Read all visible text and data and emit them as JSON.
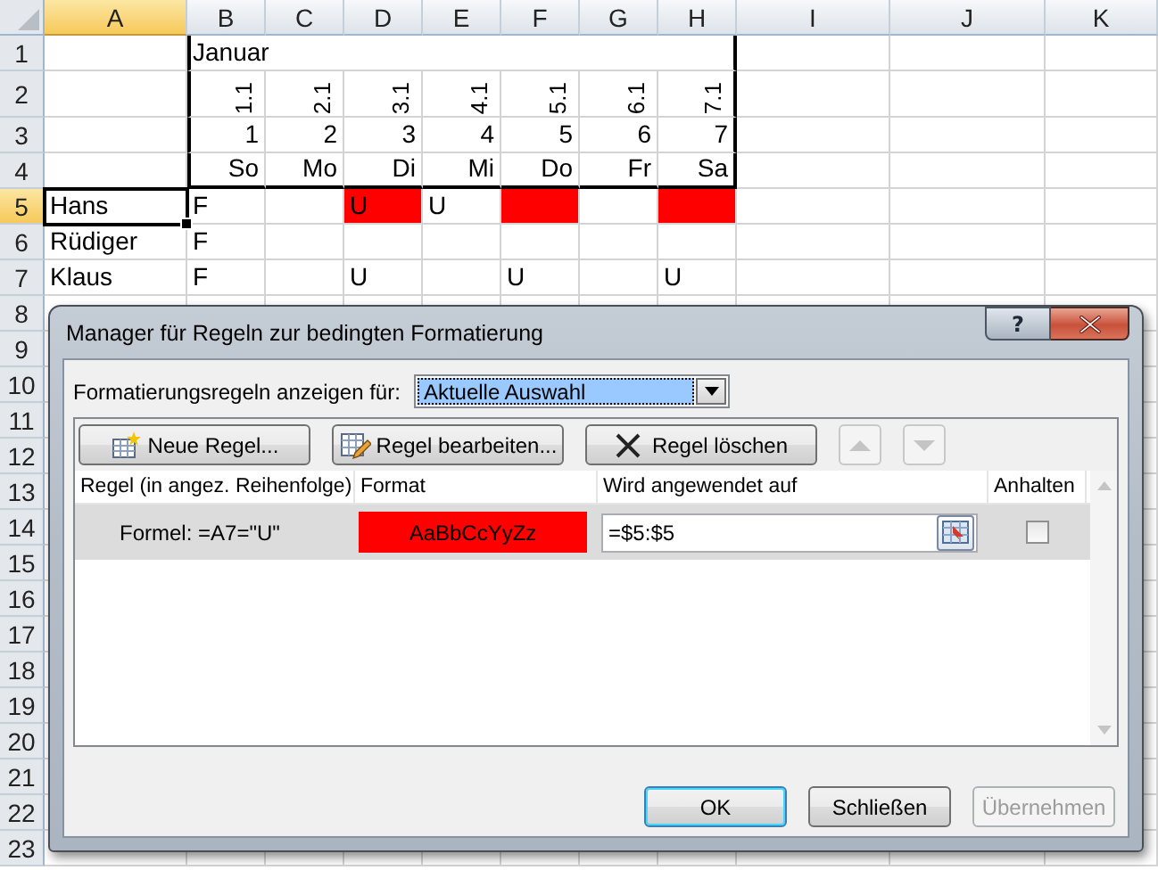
{
  "spreadsheet": {
    "columns": [
      {
        "label": "A",
        "selected": true
      },
      {
        "label": "B",
        "selected": false
      },
      {
        "label": "C",
        "selected": false
      },
      {
        "label": "D",
        "selected": false
      },
      {
        "label": "E",
        "selected": false
      },
      {
        "label": "F",
        "selected": false
      },
      {
        "label": "G",
        "selected": false
      },
      {
        "label": "H",
        "selected": false
      },
      {
        "label": "I",
        "selected": false
      },
      {
        "label": "J",
        "selected": false
      },
      {
        "label": "K",
        "selected": false
      }
    ],
    "rows": [
      {
        "number": "1",
        "selected": false,
        "cells": [
          {},
          {
            "text": "Januar",
            "kind": "text",
            "merged": true
          }
        ]
      },
      {
        "number": "2",
        "selected": false,
        "rotated": true,
        "cells": [
          {},
          {
            "text": "1.1",
            "kind": "value"
          },
          {
            "text": "2.1",
            "kind": "value"
          },
          {
            "text": "3.1",
            "kind": "value"
          },
          {
            "text": "4.1",
            "kind": "value"
          },
          {
            "text": "5.1",
            "kind": "value"
          },
          {
            "text": "6.1",
            "kind": "value"
          },
          {
            "text": "7.1",
            "kind": "value"
          }
        ]
      },
      {
        "number": "3",
        "selected": false,
        "cells": [
          {},
          {
            "text": "1",
            "kind": "value"
          },
          {
            "text": "2",
            "kind": "value"
          },
          {
            "text": "3",
            "kind": "value"
          },
          {
            "text": "4",
            "kind": "value"
          },
          {
            "text": "5",
            "kind": "value"
          },
          {
            "text": "6",
            "kind": "value"
          },
          {
            "text": "7",
            "kind": "value"
          }
        ]
      },
      {
        "number": "4",
        "selected": false,
        "cells": [
          {},
          {
            "text": "So",
            "kind": "value"
          },
          {
            "text": "Mo",
            "kind": "value"
          },
          {
            "text": "Di",
            "kind": "value"
          },
          {
            "text": "Mi",
            "kind": "value"
          },
          {
            "text": "Do",
            "kind": "value"
          },
          {
            "text": "Fr",
            "kind": "value"
          },
          {
            "text": "Sa",
            "kind": "value"
          }
        ]
      },
      {
        "number": "5",
        "selected": true,
        "cells": [
          {
            "text": "Hans",
            "kind": "text",
            "selected": true,
            "highlighted": false
          },
          {
            "text": "F",
            "kind": "text",
            "selected": false,
            "highlighted": false
          },
          {
            "selected": false,
            "highlighted": false
          },
          {
            "text": "U",
            "kind": "text",
            "selected": false,
            "highlighted": true
          },
          {
            "text": "U",
            "kind": "text",
            "selected": false,
            "highlighted": false
          },
          {
            "selected": false,
            "highlighted": true
          },
          {
            "selected": false,
            "highlighted": false
          },
          {
            "selected": false,
            "highlighted": true
          }
        ]
      },
      {
        "number": "6",
        "selected": false,
        "cells": [
          {
            "text": "Rüdiger",
            "kind": "text",
            "selected": false,
            "highlighted": false
          },
          {
            "text": "F",
            "kind": "text",
            "selected": false,
            "highlighted": false
          }
        ]
      },
      {
        "number": "7",
        "selected": false,
        "cells": [
          {
            "text": "Klaus",
            "kind": "text",
            "selected": false,
            "highlighted": false
          },
          {
            "text": "F",
            "kind": "text",
            "selected": false,
            "highlighted": false
          },
          {},
          {
            "text": "U",
            "kind": "text",
            "selected": false,
            "highlighted": false
          },
          {},
          {
            "text": "U",
            "kind": "text",
            "selected": false,
            "highlighted": false
          },
          {},
          {
            "text": "U",
            "kind": "text",
            "selected": false,
            "highlighted": false
          }
        ]
      },
      {
        "number": "8",
        "selected": false
      },
      {
        "number": "9",
        "selected": false
      },
      {
        "number": "10",
        "selected": false
      },
      {
        "number": "11",
        "selected": false
      },
      {
        "number": "12",
        "selected": false
      },
      {
        "number": "13",
        "selected": false
      },
      {
        "number": "14",
        "selected": false
      },
      {
        "number": "15",
        "selected": false
      },
      {
        "number": "16",
        "selected": false
      },
      {
        "number": "17",
        "selected": false
      },
      {
        "number": "18",
        "selected": false
      },
      {
        "number": "19",
        "selected": false
      },
      {
        "number": "20",
        "selected": false
      },
      {
        "number": "21",
        "selected": false
      },
      {
        "number": "22",
        "selected": false
      },
      {
        "number": "23",
        "selected": false
      }
    ]
  },
  "dialog": {
    "title": "Manager für Regeln zur bedingten Formatierung",
    "help": "?",
    "scope": {
      "label": "Formatierungsregeln anzeigen für:",
      "value": "Aktuelle Auswahl"
    },
    "toolbar": [
      {
        "kind": "new",
        "label": "Neue Regel...",
        "disabled": false
      },
      {
        "kind": "edit",
        "label": "Regel bearbeiten...",
        "disabled": false
      },
      {
        "kind": "delete",
        "label": "Regel löschen",
        "disabled": false
      },
      {
        "kind": "up",
        "disabled": true
      },
      {
        "kind": "down",
        "disabled": true
      }
    ],
    "rules_table": {
      "columns": [
        "Regel (in angez. Reihenfolge)",
        "Format",
        "Wird angewendet auf",
        "Anhalten"
      ],
      "rows": [
        {
          "rule": "Formel: =A7=\"U\"",
          "format_preview": "AaBbCcYyZz",
          "color": "#ff0000",
          "applies_to": "=$5:$5",
          "stop": false,
          "selected": true
        }
      ]
    },
    "buttons": [
      {
        "label": "OK",
        "default": true,
        "disabled": false
      },
      {
        "label": "Schließen",
        "default": false,
        "disabled": false
      },
      {
        "label": "Übernehmen",
        "default": false,
        "disabled": true
      }
    ]
  }
}
